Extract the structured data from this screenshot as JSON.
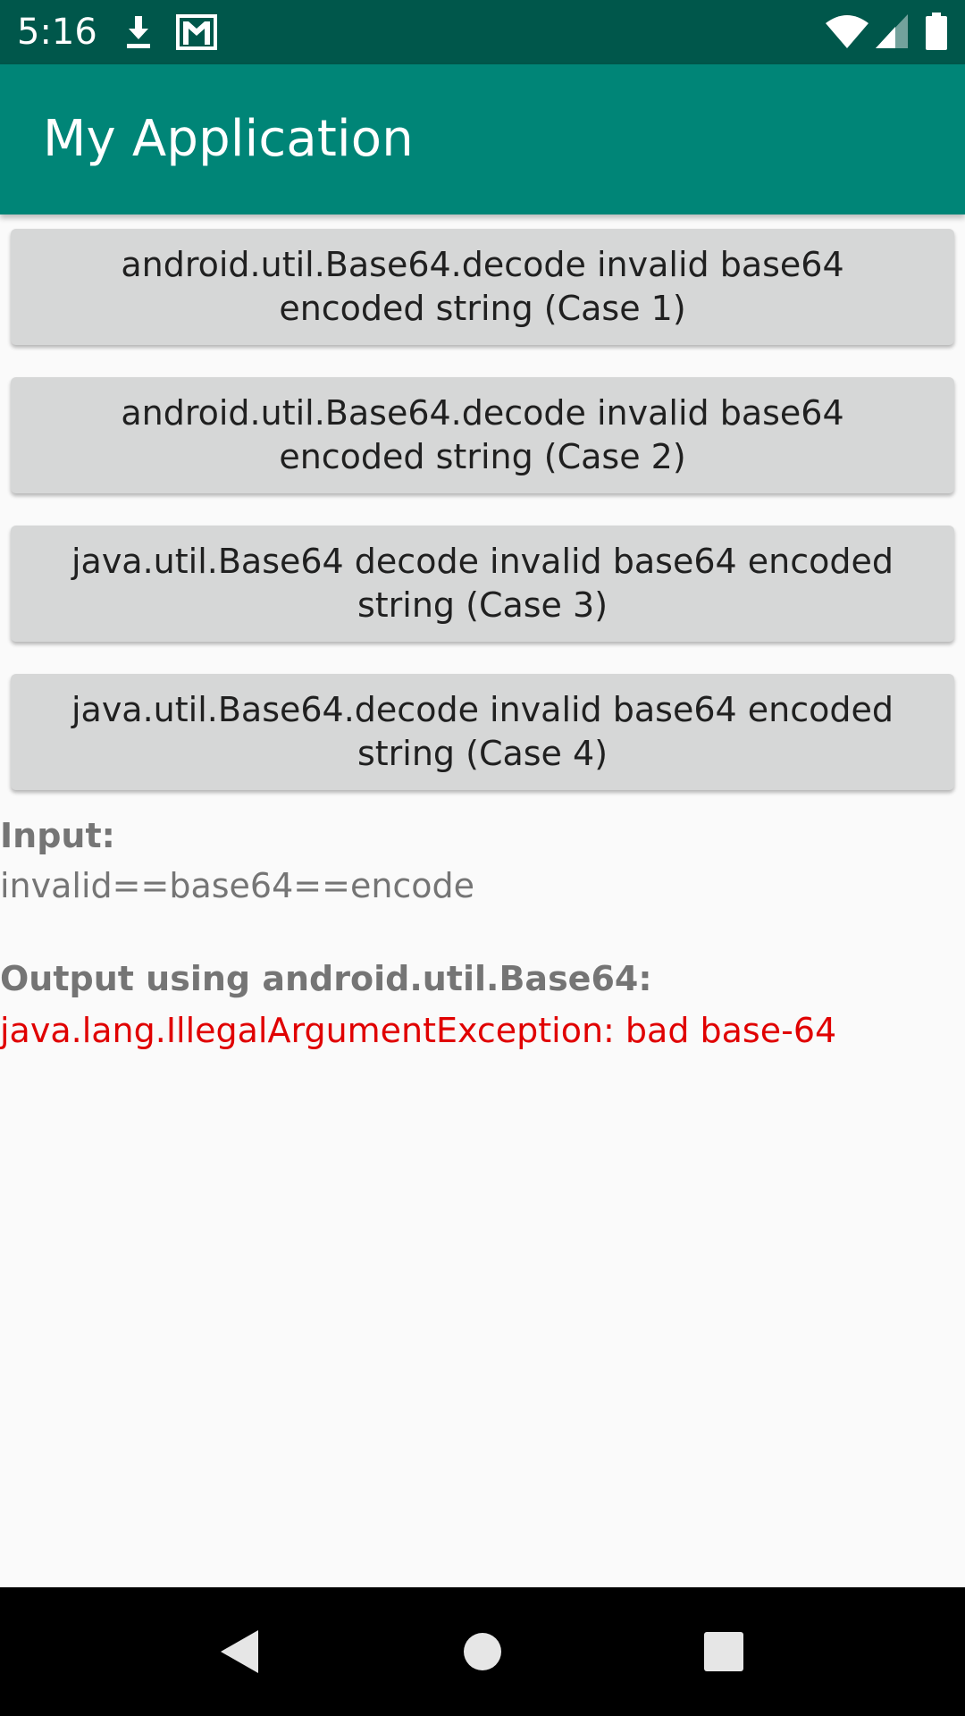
{
  "status_bar": {
    "time": "5:16",
    "icons": [
      "download-icon",
      "gmail-icon",
      "wifi-icon",
      "signal-icon",
      "battery-icon"
    ]
  },
  "app_bar": {
    "title": "My Application",
    "color": "#008577",
    "status_color": "#00574b"
  },
  "buttons": [
    {
      "label": "android.util.Base64.decode invalid base64 encoded string (Case 1)"
    },
    {
      "label": "android.util.Base64.decode invalid base64 encoded string (Case 2)"
    },
    {
      "label": "java.util.Base64 decode invalid base64 encoded string (Case 3)"
    },
    {
      "label": "java.util.Base64.decode invalid base64 encoded string (Case 4)"
    }
  ],
  "result": {
    "input_label": "Input:",
    "input_value": "invalid==base64==encode",
    "output_label": "Output using android.util.Base64:",
    "output_value": "java.lang.IllegalArgumentException: bad base-64",
    "error_color": "#e00000"
  },
  "nav_bar": {
    "icons": [
      "back-icon",
      "home-icon",
      "recents-icon"
    ]
  }
}
